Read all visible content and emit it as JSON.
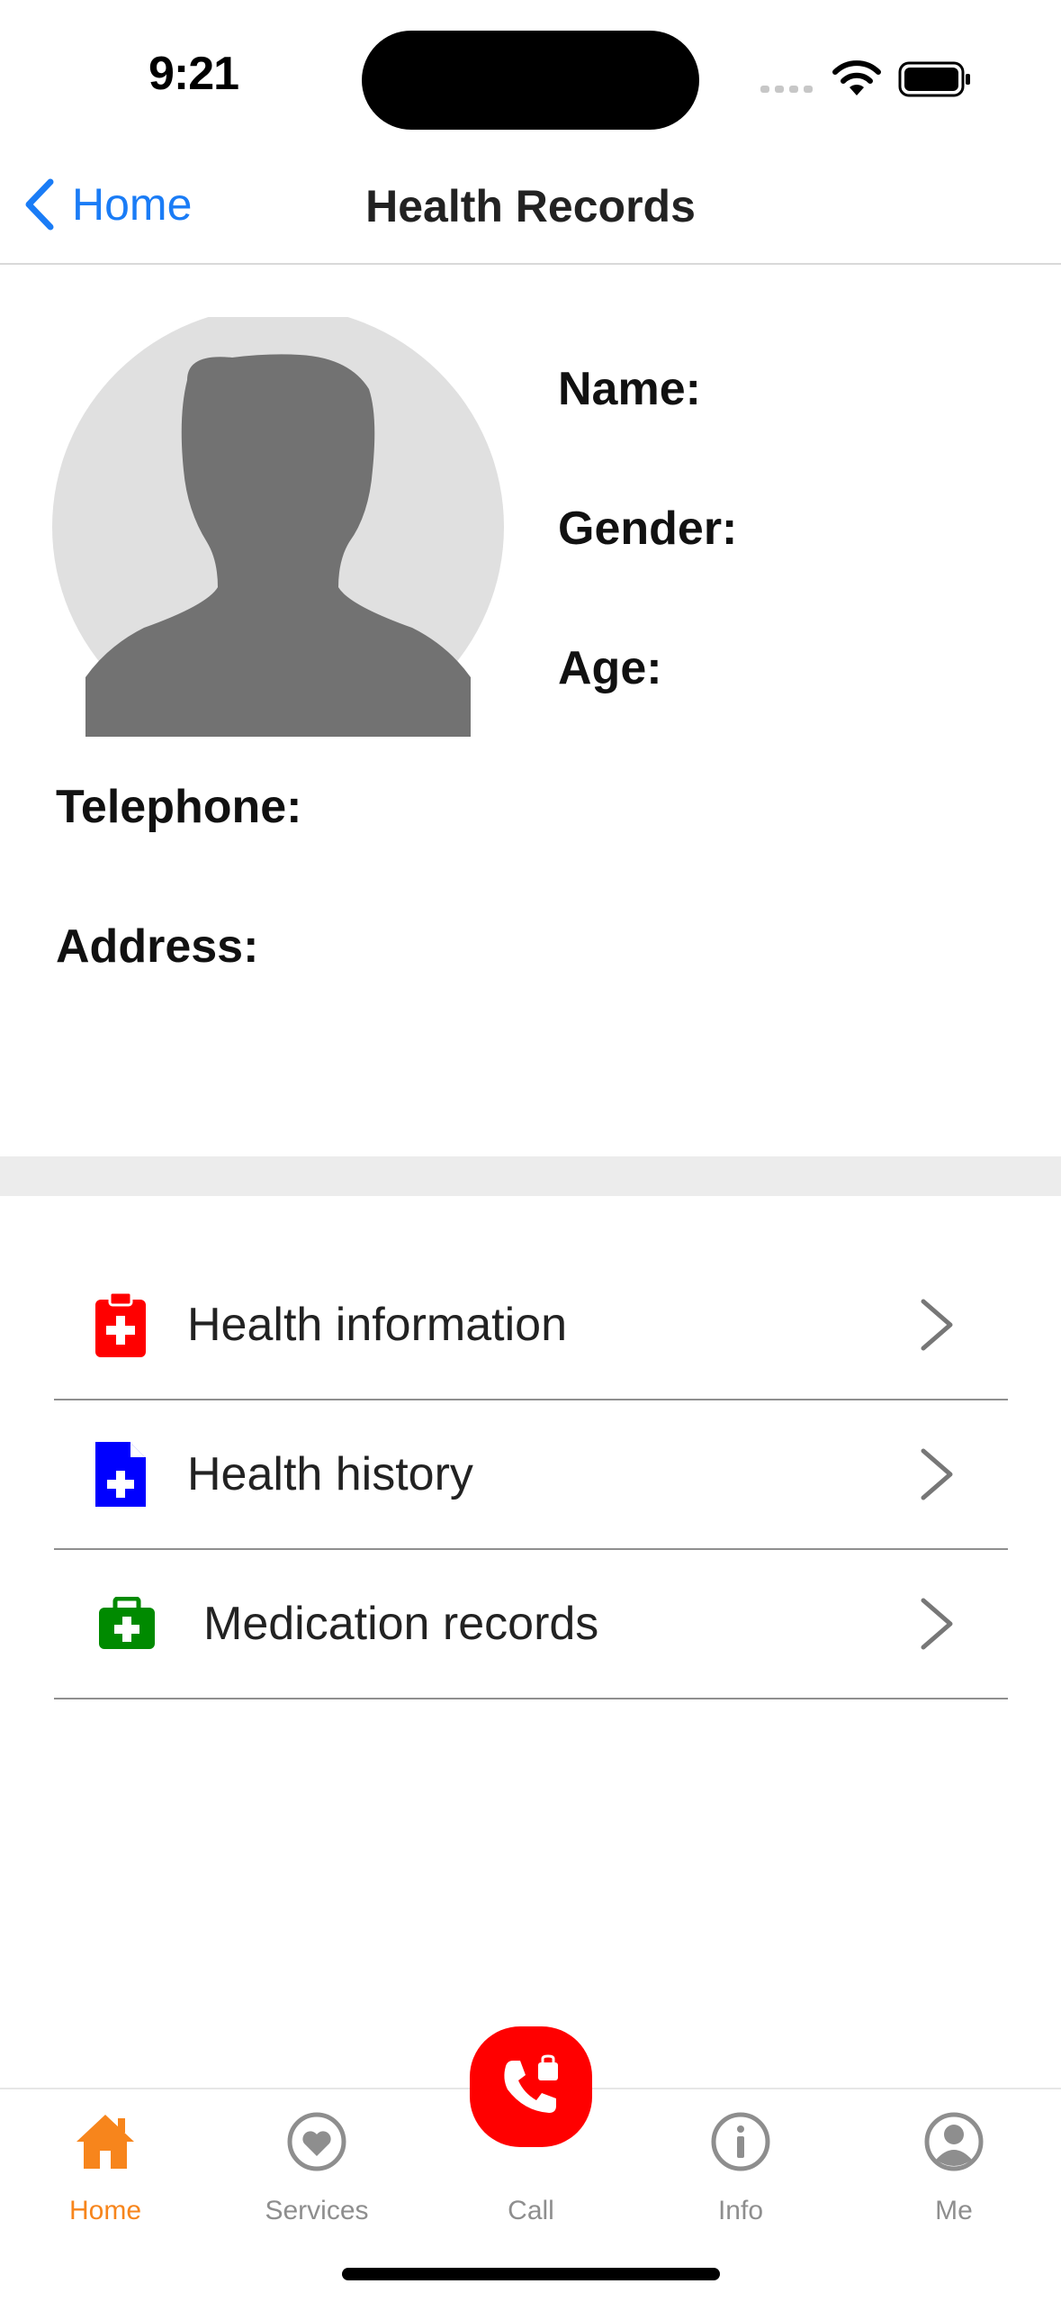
{
  "status_bar": {
    "time": "9:21"
  },
  "nav": {
    "back_label": "Home",
    "title": "Health Records"
  },
  "profile": {
    "name_label": "Name:",
    "gender_label": "Gender:",
    "age_label": "Age:",
    "telephone_label": "Telephone:",
    "address_label": "Address:",
    "avatar_icon": "person-silhouette-icon"
  },
  "menu": {
    "items": [
      {
        "label": "Health information",
        "icon": "clipboard-medical-icon",
        "color": "#ff0000"
      },
      {
        "label": "Health history",
        "icon": "medical-document-icon",
        "color": "#0000ff"
      },
      {
        "label": "Medication records",
        "icon": "medical-kit-icon",
        "color": "#008a00"
      }
    ]
  },
  "tabbar": {
    "tabs": [
      {
        "label": "Home",
        "icon": "home-icon",
        "active": true
      },
      {
        "label": "Services",
        "icon": "heart-icon",
        "active": false
      },
      {
        "label": "Call",
        "icon": "phone-icon",
        "active": false
      },
      {
        "label": "Info",
        "icon": "info-icon",
        "active": false
      },
      {
        "label": "Me",
        "icon": "user-icon",
        "active": false
      }
    ],
    "active_color": "#f7851c",
    "call_button_color": "#ff0000"
  }
}
